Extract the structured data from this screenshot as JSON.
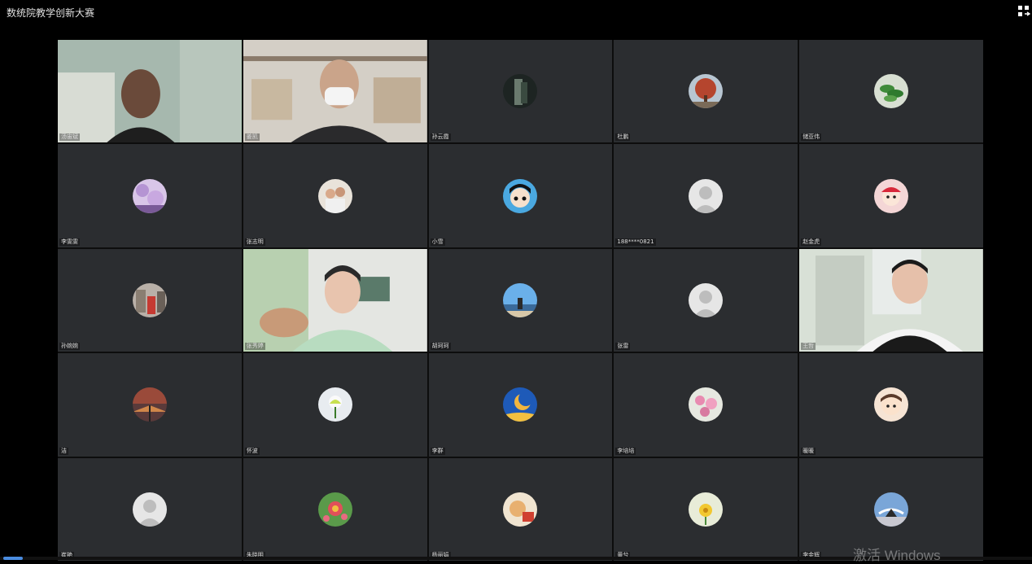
{
  "window": {
    "title": "数统院教学创新大赛",
    "layout_icon": "grid-layout-icon"
  },
  "participants": [
    {
      "name": "汤宙斌",
      "video": "man-office"
    },
    {
      "name": "姜凯",
      "video": "man-mask"
    },
    {
      "name": "孙云霞",
      "avatar": "dark"
    },
    {
      "name": "杜鹏",
      "avatar": "tree"
    },
    {
      "name": "储亚伟",
      "avatar": "plant"
    },
    {
      "name": "李雯雯",
      "avatar": "blossom"
    },
    {
      "name": "张志明",
      "avatar": "family"
    },
    {
      "name": "小雪",
      "avatar": "cartoon"
    },
    {
      "name": "188****0821",
      "avatar": "default"
    },
    {
      "name": "赵金虎",
      "avatar": "mascot"
    },
    {
      "name": "孙婉婉",
      "avatar": "street"
    },
    {
      "name": "张秀婷",
      "video": "woman-green"
    },
    {
      "name": "胡珂珂",
      "avatar": "beach"
    },
    {
      "name": "张雷",
      "avatar": "default"
    },
    {
      "name": "王哲",
      "video": "woman-vest"
    },
    {
      "name": "洁",
      "avatar": "sunset"
    },
    {
      "name": "怀波",
      "avatar": "flower-white"
    },
    {
      "name": "李群",
      "avatar": "moon"
    },
    {
      "name": "李培培",
      "avatar": "flower-pink"
    },
    {
      "name": "暖暖",
      "avatar": "child"
    },
    {
      "name": "崔艳",
      "avatar": "default"
    },
    {
      "name": "朱晓明",
      "avatar": "flower-red"
    },
    {
      "name": "杨丽娟",
      "avatar": "food"
    },
    {
      "name": "黄兮",
      "avatar": "flower-yellow"
    },
    {
      "name": "李金辉",
      "avatar": "sky"
    }
  ],
  "watermark": "激活 Windows",
  "colors": {
    "background": "#000000",
    "tile": "#2b2d30",
    "active_border": "#47c05b"
  }
}
